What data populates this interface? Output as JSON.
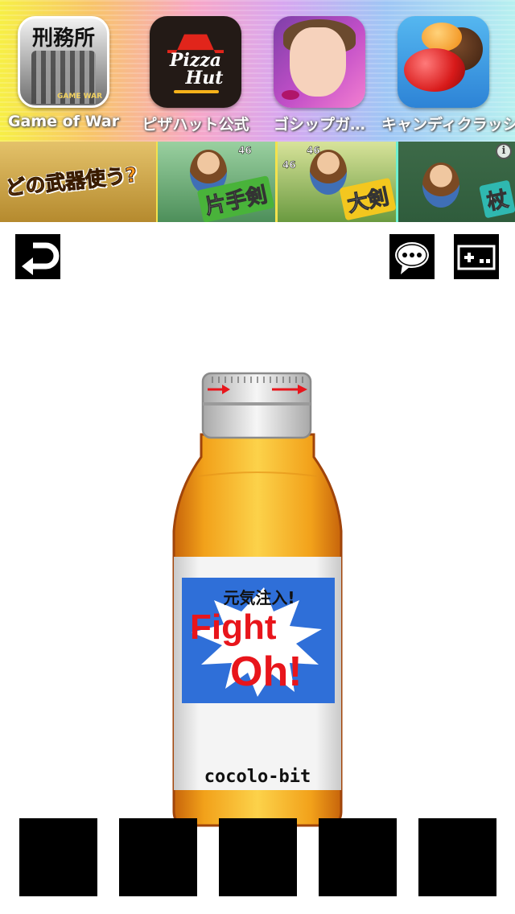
{
  "app_banner": {
    "apps": [
      {
        "label": "Game of War",
        "icon": "game-of-war-icon",
        "icon_text": "刑務所",
        "badge": "GAME WAR"
      },
      {
        "label": "ピザハット公式",
        "icon": "pizza-hut-icon",
        "icon_text_line1": "Pizza",
        "icon_text_line2": "Hut"
      },
      {
        "label": "ゴシップガ…",
        "icon": "gossip-girl-anime-icon"
      },
      {
        "label": "キャンディクラッシュ",
        "icon": "candy-crush-icon"
      }
    ]
  },
  "game_ad": {
    "headline": "どの武器使う?",
    "tags": [
      "片手剣",
      "大剣",
      "杖"
    ],
    "info_label": "i",
    "numbers": [
      "46",
      "46",
      "46",
      "46"
    ]
  },
  "toolbar": {
    "back_icon": "return-arrow-icon",
    "chat_icon": "speech-bubble-icon",
    "menu_icon": "game-controller-icon"
  },
  "bottle": {
    "label_top": "元気注入!",
    "label_word1": "Fight",
    "label_word2": "Oh!",
    "brand": "cocolo-bit",
    "colors": {
      "liquid": "#f2b21c",
      "label_blue": "#2f6fd8",
      "label_red": "#e8151b",
      "cap": "#e6e6e6",
      "arrow": "#e8151b"
    }
  },
  "inventory": {
    "slots": [
      "",
      "",
      "",
      "",
      ""
    ]
  }
}
